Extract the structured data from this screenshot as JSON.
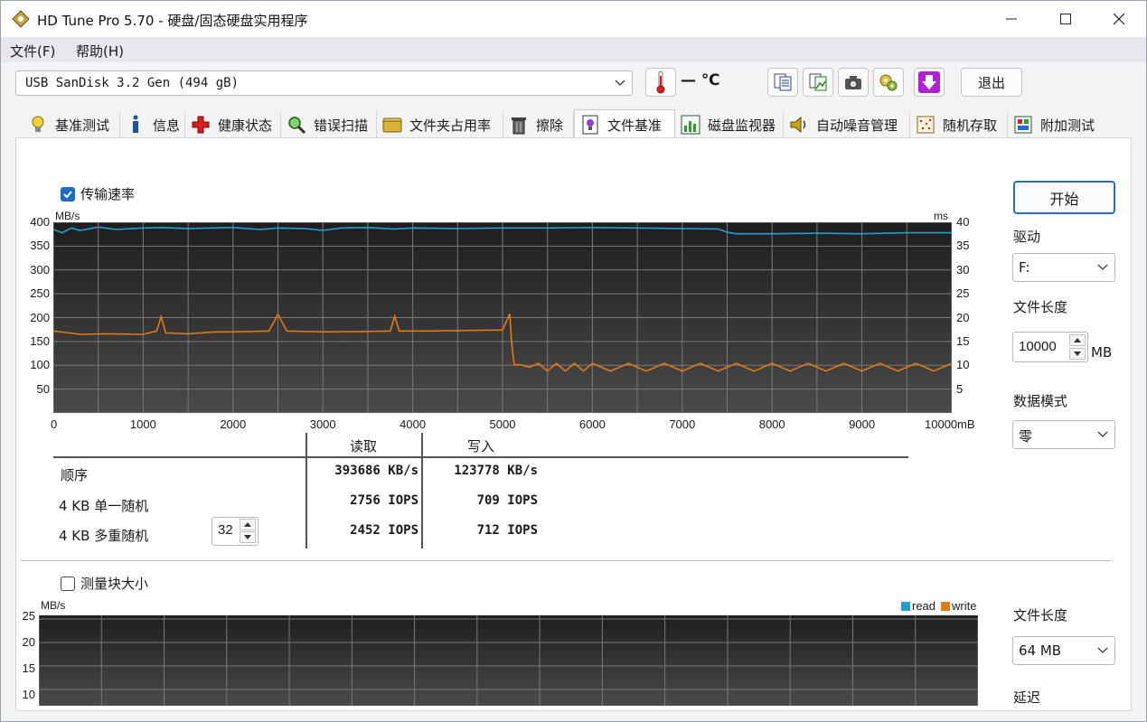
{
  "window": {
    "title": "HD Tune Pro 5.70 - 硬盘/固态硬盘实用程序",
    "minimize_glyph": "—",
    "maximize_glyph": "☐",
    "close_glyph": "✕"
  },
  "menu": [
    {
      "label": "文件(F)"
    },
    {
      "label": "帮助(H)"
    }
  ],
  "toolbar": {
    "drive": "USB SanDisk 3.2 Gen (494 gB)",
    "temperature": "— ℃",
    "exit_label": "退出",
    "icons": [
      "thermometer-icon",
      "copy-text-icon",
      "copy-image-icon",
      "camera-icon",
      "options-icon",
      "save-down-icon"
    ]
  },
  "tabs": [
    {
      "label": "基准测试",
      "icon": "lightbulb-icon"
    },
    {
      "label": "信息",
      "icon": "info-icon"
    },
    {
      "label": "健康状态",
      "icon": "health-cross-icon"
    },
    {
      "label": "错误扫描",
      "icon": "magnifier-icon"
    },
    {
      "label": "文件夹占用率",
      "icon": "folder-icon"
    },
    {
      "label": "擦除",
      "icon": "trash-icon"
    },
    {
      "label": "文件基准",
      "icon": "file-bench-icon",
      "active": true
    },
    {
      "label": "磁盘监视器",
      "icon": "monitor-chart-icon"
    },
    {
      "label": "自动噪音管理",
      "icon": "speaker-icon"
    },
    {
      "label": "随机存取",
      "icon": "random-access-icon"
    },
    {
      "label": "附加测试",
      "icon": "extra-tests-icon"
    }
  ],
  "transfer": {
    "checkbox_label": "传输速率",
    "checked": true,
    "left_unit": "MB/s",
    "right_unit": "ms",
    "x_unit": "mB",
    "y_ticks": [
      "400",
      "350",
      "300",
      "250",
      "200",
      "150",
      "100",
      "50"
    ],
    "y2_ticks": [
      "40",
      "35",
      "30",
      "25",
      "20",
      "15",
      "10",
      "5"
    ],
    "x_ticks": [
      "0",
      "1000",
      "2000",
      "3000",
      "4000",
      "5000",
      "6000",
      "7000",
      "8000",
      "9000",
      "10000"
    ]
  },
  "results": {
    "read_header": "读取",
    "write_header": "写入",
    "rows": [
      {
        "label": "顺序",
        "read": "393686 KB/s",
        "write": "123778 KB/s"
      },
      {
        "label": "4 KB 单一随机",
        "read": "2756 IOPS",
        "write": "709 IOPS"
      },
      {
        "label": "4 KB 多重随机",
        "read": "2452 IOPS",
        "write": "712 IOPS"
      }
    ],
    "queue_depth": "32"
  },
  "block": {
    "checkbox_label": "测量块大小",
    "checked": false,
    "unit": "MB/s",
    "y_ticks": [
      "25",
      "20",
      "15",
      "10"
    ],
    "legend_read": "read",
    "legend_write": "write"
  },
  "right": {
    "start_label": "开始",
    "drive_label": "驱动",
    "drive_value": "F:",
    "file_length_label": "文件长度",
    "file_length_value": "10000",
    "file_length_unit": "MB",
    "data_mode_label": "数据模式",
    "data_mode_value": "零",
    "file_length2_label": "文件长度",
    "file_length2_value": "64 MB",
    "delay_label": "延迟"
  },
  "colors": {
    "read": "#1e9fd0",
    "write": "#e07a14",
    "chart_bg": "#2b2b2b",
    "accent": "#1c6bc4"
  },
  "chart_data": {
    "type": "line",
    "title": "",
    "xlabel": "mB",
    "ylabel": "MB/s",
    "y2label": "ms",
    "xlim": [
      0,
      10000
    ],
    "ylim": [
      0,
      400
    ],
    "y2lim": [
      0,
      40
    ],
    "grid": true,
    "series": [
      {
        "name": "read",
        "x": [
          0,
          100,
          200,
          300,
          500,
          700,
          1000,
          1200,
          1500,
          2000,
          2300,
          2500,
          2800,
          3000,
          3200,
          3500,
          3800,
          4000,
          4500,
          5000,
          5500,
          6000,
          6500,
          7000,
          7400,
          7500,
          7600,
          8000,
          8500,
          9000,
          9500,
          10000
        ],
        "values": [
          385,
          378,
          388,
          383,
          390,
          385,
          388,
          389,
          387,
          389,
          385,
          388,
          387,
          383,
          388,
          389,
          386,
          388,
          387,
          388,
          388,
          389,
          388,
          387,
          386,
          379,
          376,
          376,
          377,
          376,
          378,
          378
        ]
      },
      {
        "name": "write",
        "x": [
          0,
          300,
          600,
          1000,
          1150,
          1200,
          1250,
          1500,
          1800,
          2000,
          2400,
          2500,
          2600,
          3000,
          3500,
          3750,
          3800,
          3850,
          4200,
          4600,
          5000,
          5080,
          5100,
          5130,
          5200,
          5300,
          5400,
          5500,
          5600,
          5700,
          5800,
          5900,
          6000,
          6200,
          6400,
          6600,
          6800,
          7000,
          7200,
          7400,
          7600,
          7800,
          8000,
          8200,
          8400,
          8600,
          8800,
          9000,
          9200,
          9400,
          9600,
          9800,
          10000
        ],
        "values": [
          172,
          165,
          166,
          165,
          172,
          202,
          168,
          166,
          170,
          170,
          172,
          207,
          172,
          170,
          171,
          172,
          203,
          172,
          172,
          173,
          174,
          208,
          150,
          101,
          101,
          96,
          104,
          88,
          104,
          88,
          104,
          88,
          104,
          88,
          104,
          88,
          104,
          88,
          104,
          88,
          104,
          88,
          104,
          88,
          104,
          88,
          104,
          88,
          104,
          88,
          104,
          88,
          104
        ]
      }
    ]
  }
}
